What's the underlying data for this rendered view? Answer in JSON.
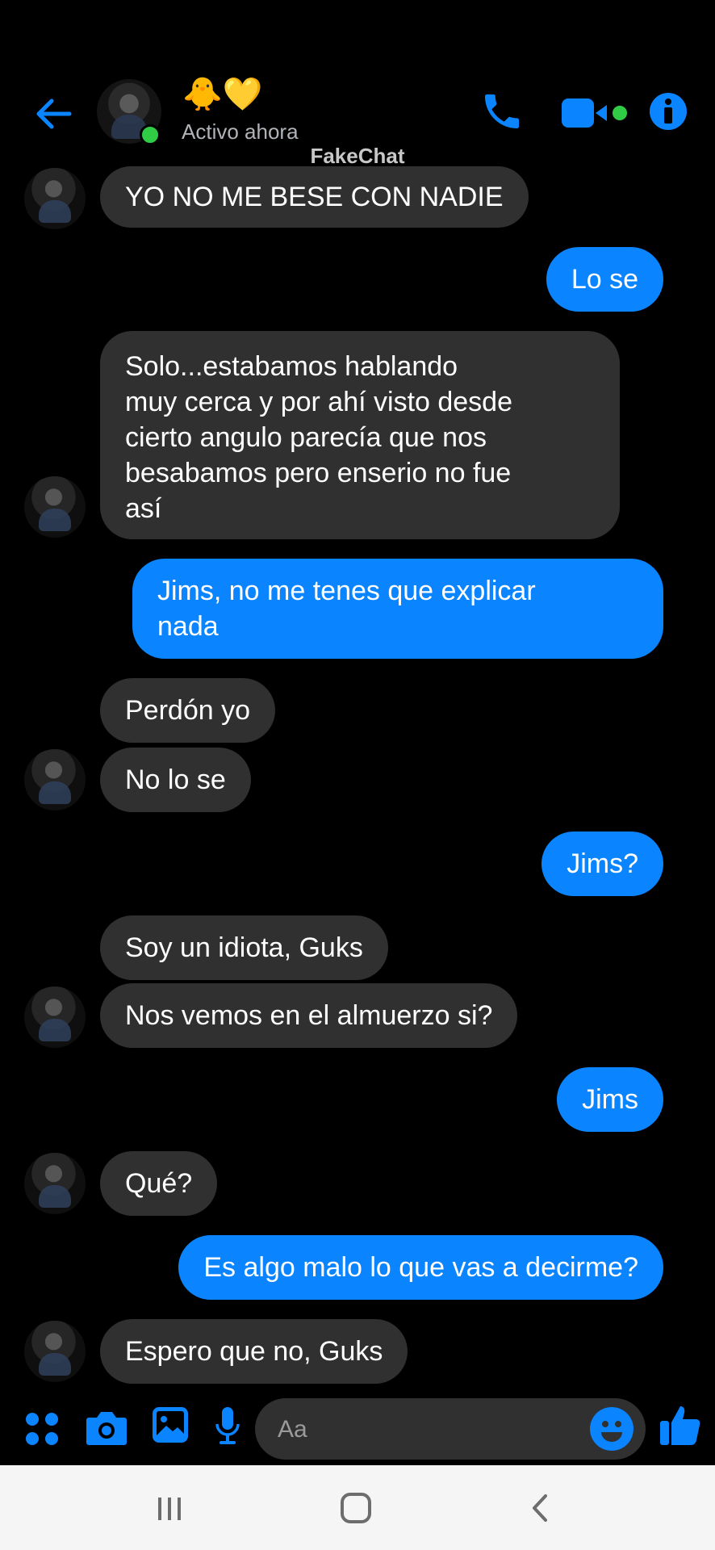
{
  "header": {
    "contact_name": "🐥💛",
    "status": "Activo ahora",
    "watermark": "FakeChat"
  },
  "messages": [
    {
      "sender": "them",
      "text": "YO NO ME BESE CON NADIE"
    },
    {
      "sender": "me",
      "text": "Lo se"
    },
    {
      "sender": "them",
      "text": "Solo...estabamos hablando\nmuy cerca y por ahí visto desde\ncierto angulo parecía que nos\nbesabamos pero enserio no fue\nasí"
    },
    {
      "sender": "me",
      "text": "Jims, no me tenes que explicar\nnada"
    },
    {
      "sender": "them",
      "text": "Perdón yo"
    },
    {
      "sender": "them",
      "text": "No lo se"
    },
    {
      "sender": "me",
      "text": "Jims?"
    },
    {
      "sender": "them",
      "text": "Soy un idiota, Guks"
    },
    {
      "sender": "them",
      "text": "Nos vemos en el almuerzo si?"
    },
    {
      "sender": "me",
      "text": "Jims"
    },
    {
      "sender": "them",
      "text": "Qué?"
    },
    {
      "sender": "me",
      "text": "Es algo malo lo que vas a decirme?"
    },
    {
      "sender": "them",
      "text": "Espero que no, Guks"
    }
  ],
  "composer": {
    "placeholder": "Aa"
  },
  "colors": {
    "accent": "#0a84ff",
    "incoming_bubble": "#303030",
    "online": "#31cc46",
    "background": "#000000"
  },
  "icons": [
    "back-arrow-icon",
    "phone-icon",
    "video-camera-icon",
    "info-icon",
    "menu-grid-icon",
    "camera-icon",
    "gallery-icon",
    "microphone-icon",
    "emoji-icon",
    "thumbs-up-icon"
  ]
}
